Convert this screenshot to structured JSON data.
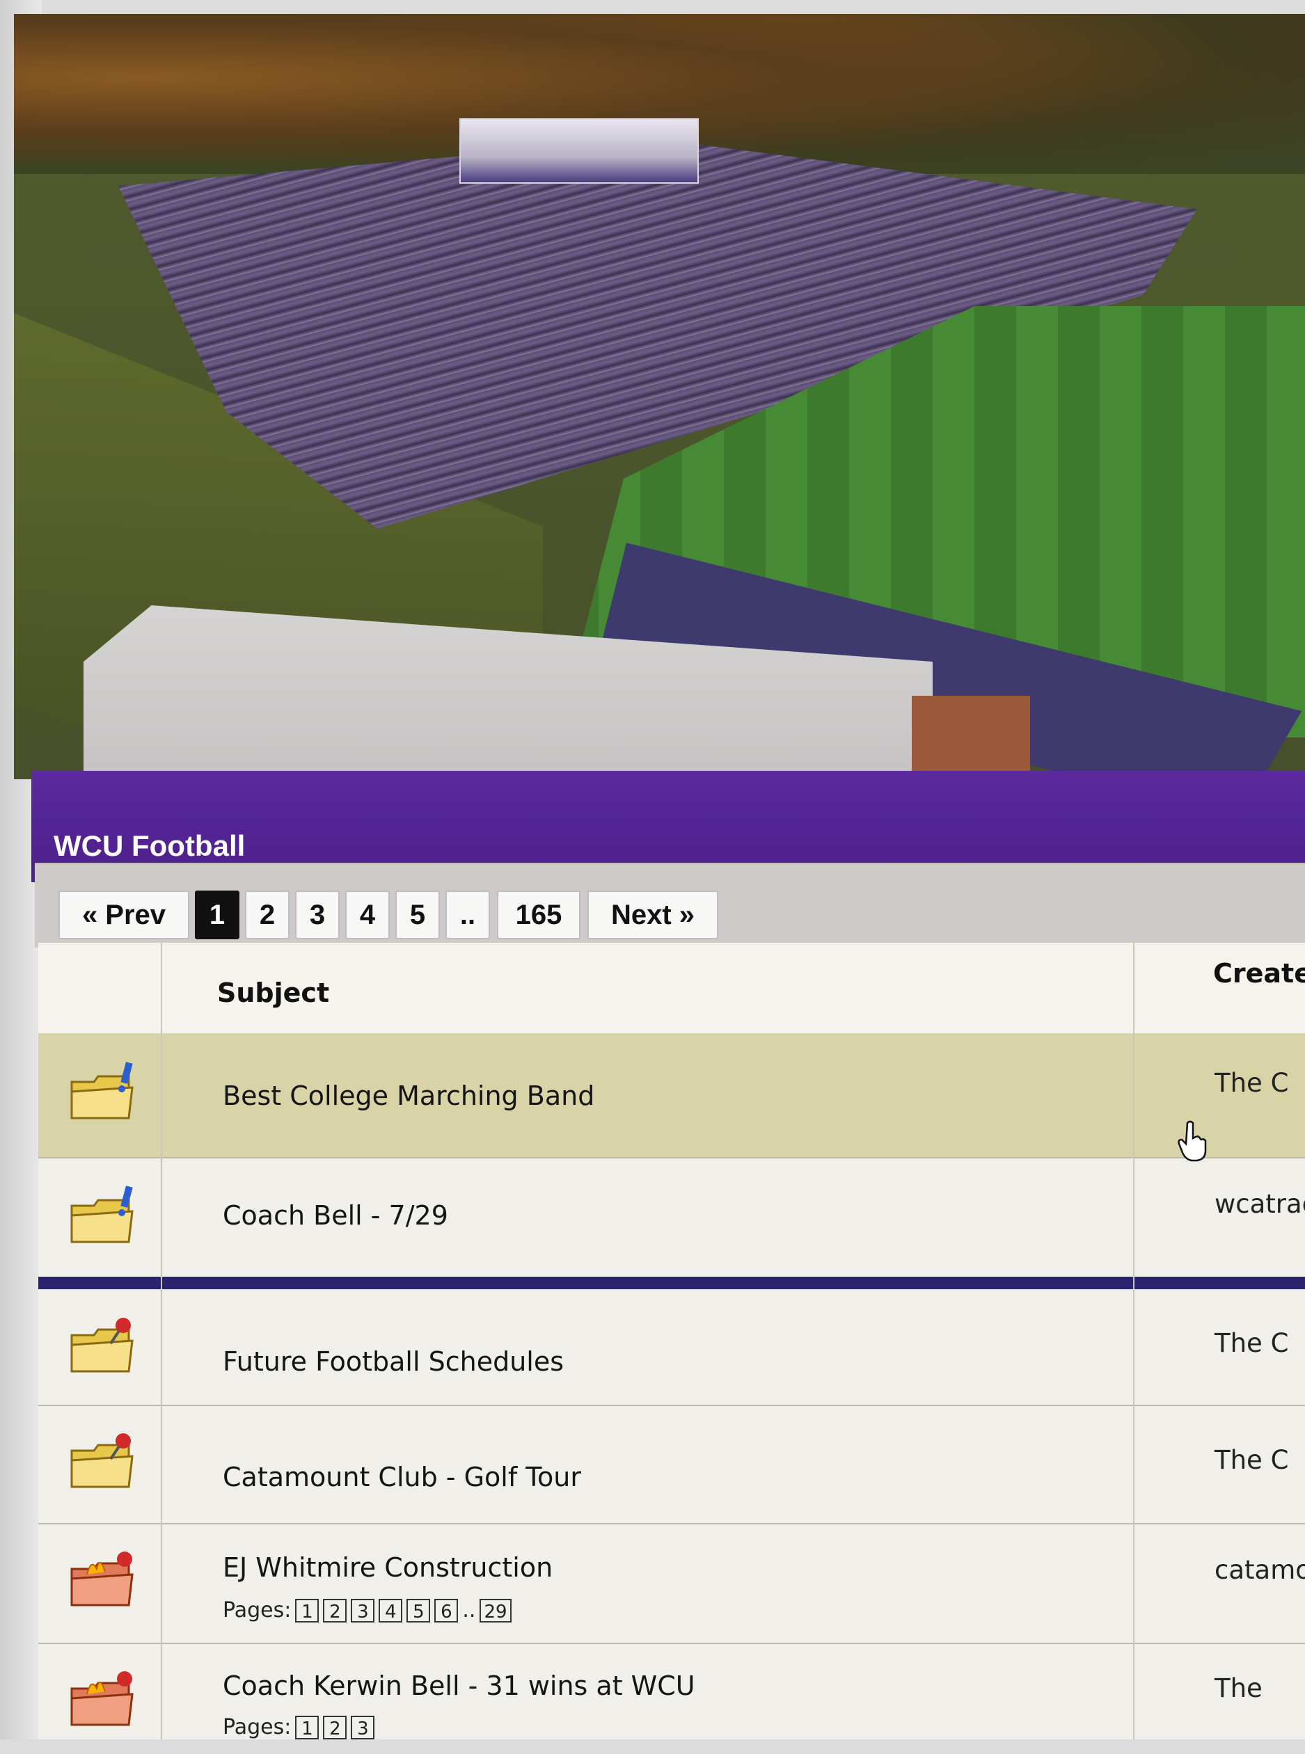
{
  "forum": {
    "title": "WCU Football"
  },
  "pagination": {
    "prev_label": "« Prev",
    "pages": [
      "1",
      "2",
      "3",
      "4",
      "5"
    ],
    "ellipsis": "..",
    "last_page": "165",
    "next_label": "Next »",
    "current": "1"
  },
  "table": {
    "columns": {
      "subject": "Subject",
      "created": "Create"
    },
    "rows": [
      {
        "subject": "Best College Marching Band",
        "creator": "The C",
        "icon": "folder-announcement-icon",
        "highlight": true
      },
      {
        "subject": "Coach Bell - 7/29",
        "creator": "wcatrac",
        "icon": "folder-announcement-icon"
      },
      {
        "subject": "Future Football Schedules",
        "creator": "The C",
        "icon": "folder-pinned-icon"
      },
      {
        "subject": "Catamount Club - Golf Tour",
        "creator": "The C",
        "icon": "folder-pinned-icon"
      },
      {
        "subject": "EJ Whitmire Construction",
        "creator": "catamour",
        "icon": "folder-hot-pinned-icon",
        "pages_label": "Pages:",
        "pages": [
          "1",
          "2",
          "3",
          "4",
          "5",
          "6"
        ],
        "pages_ellipsis": "..",
        "pages_last": "29"
      },
      {
        "subject": "Coach Kerwin Bell - 31 wins at WCU",
        "creator": "The",
        "icon": "folder-hot-pinned-icon",
        "pages_label": "Pages:",
        "pages": [
          "1",
          "2",
          "3"
        ]
      }
    ]
  },
  "colors": {
    "header_purple": "#4c1f8a",
    "divider_navy": "#2a2470",
    "highlight_row": "#d9d4a8"
  }
}
